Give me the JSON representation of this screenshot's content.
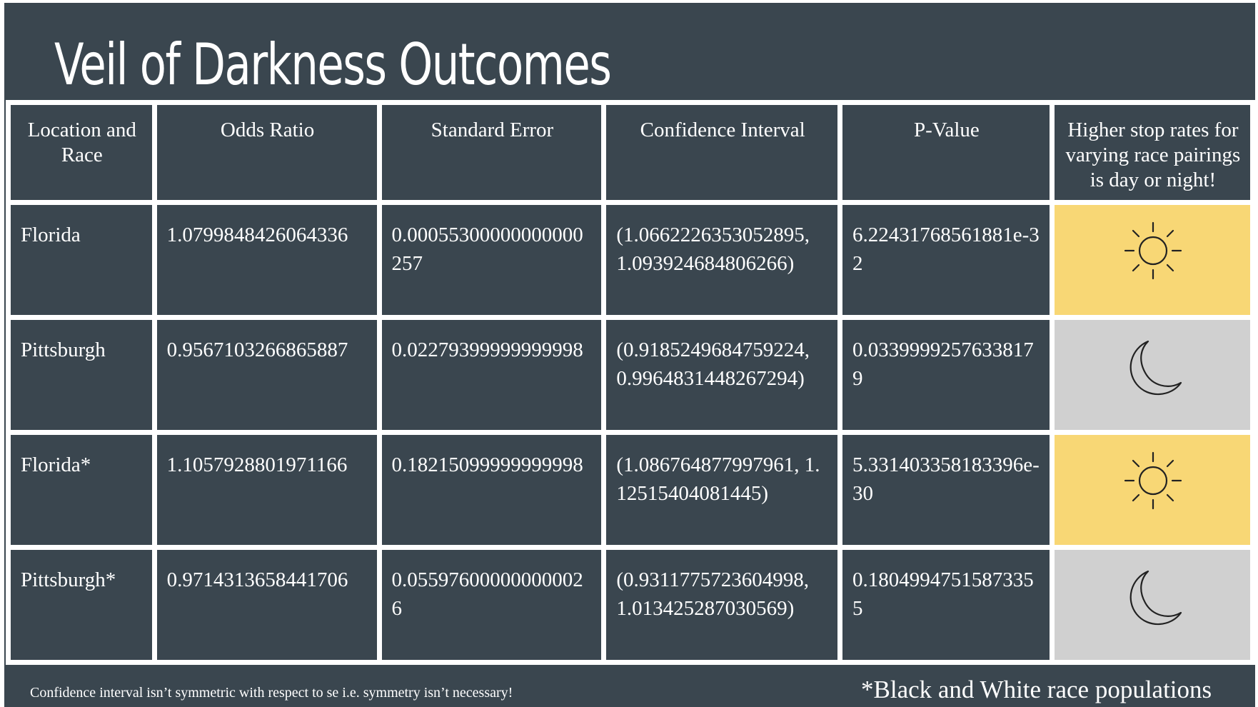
{
  "title": "Veil of Darkness Outcomes",
  "table": {
    "headers": [
      "Location and Race",
      "Odds Ratio",
      "Standard Error",
      "Confidence Interval",
      "P-Value",
      "Higher stop rates for varying race pairings is day or night!"
    ],
    "rows": [
      {
        "location": "Florida",
        "odds_ratio": "1.0799848426064336",
        "standard_error": "0.00055300000000000257",
        "confidence_interval": "(1.0662226353052895, 1.093924684806266)",
        "p_value": "6.22431768561881e-32",
        "result": "day",
        "icon": "sun-icon"
      },
      {
        "location": "Pittsburgh",
        "odds_ratio": "0.9567103266865887",
        "standard_error": "0.02279399999999998",
        "confidence_interval": "(0.9185249684759224, 0.9964831448267294)",
        "p_value": "0.03399992576338179",
        "result": "night",
        "icon": "moon-icon"
      },
      {
        "location": "Florida*",
        "odds_ratio": "1.1057928801971166",
        "standard_error": "0.18215099999999998",
        "confidence_interval": "(1.086764877997961, 1.12515404081445)",
        "p_value": "5.331403358183396e-30",
        "result": "day",
        "icon": "sun-icon"
      },
      {
        "location": "Pittsburgh*",
        "odds_ratio": "0.9714313658441706",
        "standard_error": "0.055976000000000026",
        "confidence_interval": "(0.9311775723604998, 1.013425287030569)",
        "p_value": "0.18049947515873355",
        "result": "night",
        "icon": "moon-icon"
      }
    ]
  },
  "footnote": "Confidence interval isn’t symmetric with respect to se i.e. symmetry isn’t necessary!",
  "legend_note": "*Black and White race populations",
  "colors": {
    "background": "#3a464f",
    "grid": "#ffffff",
    "day": "#f8d775",
    "night": "#d0d0d0"
  }
}
